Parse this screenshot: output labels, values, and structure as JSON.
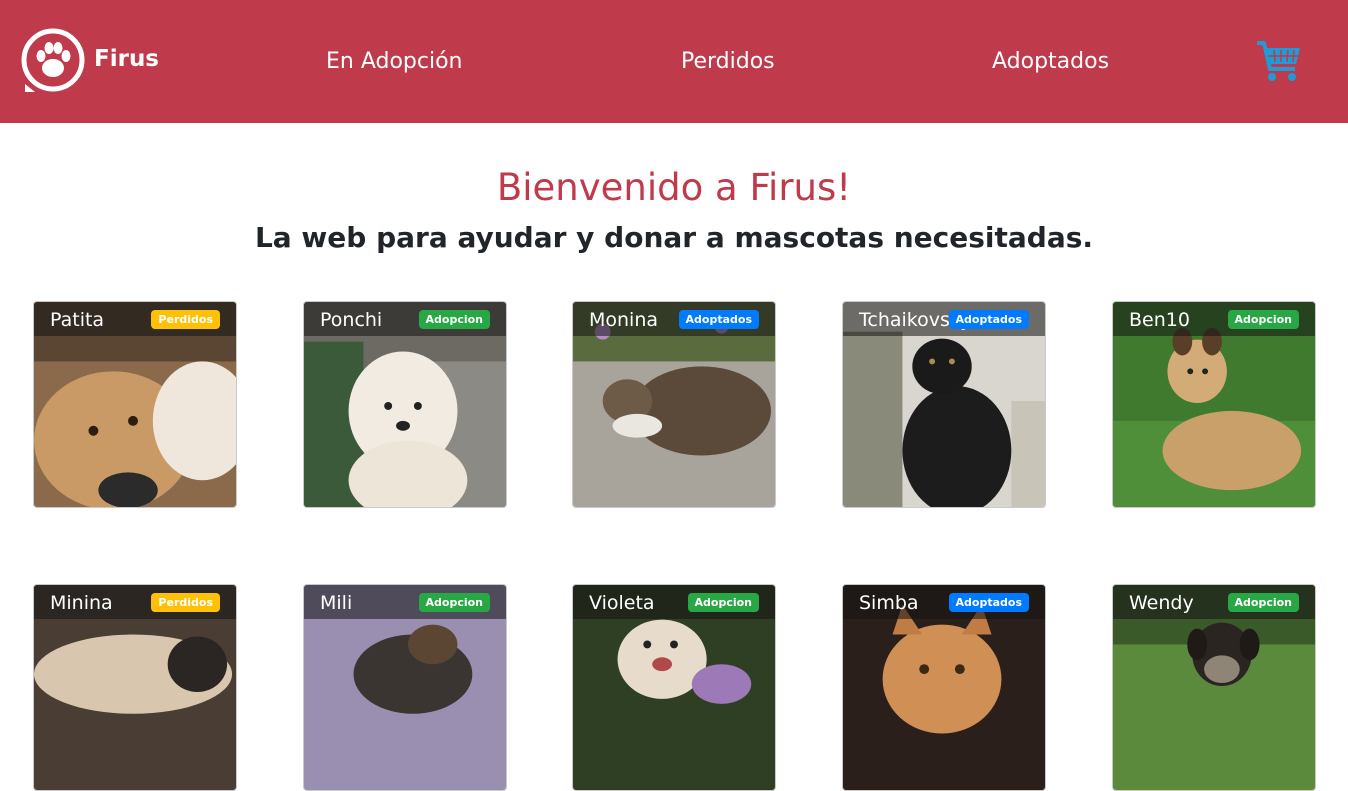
{
  "colors": {
    "brand": "#bf3a4a",
    "cart": "#1f9bd7",
    "badge_perdidos": "#ffc107",
    "badge_adopcion": "#28a745",
    "badge_adoptados": "#007bff"
  },
  "header": {
    "brand": "Firus",
    "logo_icon": "paw-icon",
    "cart_icon": "shopping-cart-icon",
    "nav": [
      "En Adopción",
      "Perdidos",
      "Adoptados"
    ]
  },
  "hero": {
    "title": "Bienvenido a Firus!",
    "subtitle": "La web para ayudar y donar a mascotas necesitadas."
  },
  "pets": [
    {
      "name": "Patita",
      "status": "Perdidos"
    },
    {
      "name": "Ponchi",
      "status": "Adopcion"
    },
    {
      "name": "Monina",
      "status": "Adoptados"
    },
    {
      "name": "Tchaikovsky",
      "status": "Adoptados"
    },
    {
      "name": "Ben10",
      "status": "Adopcion"
    },
    {
      "name": "Minina",
      "status": "Perdidos"
    },
    {
      "name": "Mili",
      "status": "Adopcion"
    },
    {
      "name": "Violeta",
      "status": "Adopcion"
    },
    {
      "name": "Simba",
      "status": "Adoptados"
    },
    {
      "name": "Wendy",
      "status": "Adopcion"
    }
  ]
}
